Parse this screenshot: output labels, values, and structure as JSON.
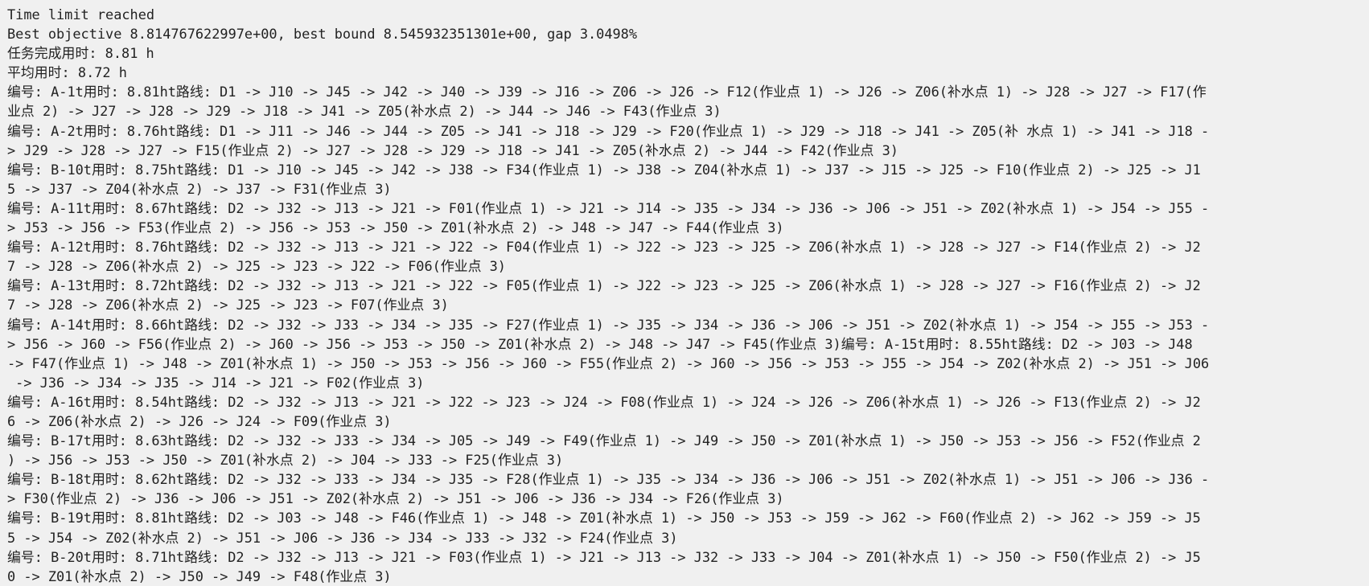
{
  "console": {
    "lines": [
      "Time limit reached",
      "Best objective 8.814767622997e+00, best bound 8.545932351301e+00, gap 3.0498%",
      "任务完成用时: 8.81 h",
      "平均用时: 8.72 h",
      "编号: A-1t用时: 8.81ht路线: D1 -> J10 -> J45 -> J42 -> J40 -> J39 -> J16 -> Z06 -> J26 -> F12(作业点 1) -> J26 -> Z06(补水点 1) -> J28 -> J27 -> F17(作",
      "业点 2) -> J27 -> J28 -> J29 -> J18 -> J41 -> Z05(补水点 2) -> J44 -> J46 -> F43(作业点 3)",
      "编号: A-2t用时: 8.76ht路线: D1 -> J11 -> J46 -> J44 -> Z05 -> J41 -> J18 -> J29 -> F20(作业点 1) -> J29 -> J18 -> J41 -> Z05(补 水点 1) -> J41 -> J18 -",
      "> J29 -> J28 -> J27 -> F15(作业点 2) -> J27 -> J28 -> J29 -> J18 -> J41 -> Z05(补水点 2) -> J44 -> F42(作业点 3)",
      "编号: B-10t用时: 8.75ht路线: D1 -> J10 -> J45 -> J42 -> J38 -> F34(作业点 1) -> J38 -> Z04(补水点 1) -> J37 -> J15 -> J25 -> F10(作业点 2) -> J25 -> J1",
      "5 -> J37 -> Z04(补水点 2) -> J37 -> F31(作业点 3)",
      "编号: A-11t用时: 8.67ht路线: D2 -> J32 -> J13 -> J21 -> F01(作业点 1) -> J21 -> J14 -> J35 -> J34 -> J36 -> J06 -> J51 -> Z02(补水点 1) -> J54 -> J55 -",
      "> J53 -> J56 -> F53(作业点 2) -> J56 -> J53 -> J50 -> Z01(补水点 2) -> J48 -> J47 -> F44(作业点 3)",
      "编号: A-12t用时: 8.76ht路线: D2 -> J32 -> J13 -> J21 -> J22 -> F04(作业点 1) -> J22 -> J23 -> J25 -> Z06(补水点 1) -> J28 -> J27 -> F14(作业点 2) -> J2",
      "7 -> J28 -> Z06(补水点 2) -> J25 -> J23 -> J22 -> F06(作业点 3)",
      "编号: A-13t用时: 8.72ht路线: D2 -> J32 -> J13 -> J21 -> J22 -> F05(作业点 1) -> J22 -> J23 -> J25 -> Z06(补水点 1) -> J28 -> J27 -> F16(作业点 2) -> J2",
      "7 -> J28 -> Z06(补水点 2) -> J25 -> J23 -> F07(作业点 3)",
      "编号: A-14t用时: 8.66ht路线: D2 -> J32 -> J33 -> J34 -> J35 -> F27(作业点 1) -> J35 -> J34 -> J36 -> J06 -> J51 -> Z02(补水点 1) -> J54 -> J55 -> J53 -",
      "> J56 -> J60 -> F56(作业点 2) -> J60 -> J56 -> J53 -> J50 -> Z01(补水点 2) -> J48 -> J47 -> F45(作业点 3)编号: A-15t用时: 8.55ht路线: D2 -> J03 -> J48",
      "-> F47(作业点 1) -> J48 -> Z01(补水点 1) -> J50 -> J53 -> J56 -> J60 -> F55(作业点 2) -> J60 -> J56 -> J53 -> J55 -> J54 -> Z02(补水点 2) -> J51 -> J06",
      " -> J36 -> J34 -> J35 -> J14 -> J21 -> F02(作业点 3)",
      "编号: A-16t用时: 8.54ht路线: D2 -> J32 -> J13 -> J21 -> J22 -> J23 -> J24 -> F08(作业点 1) -> J24 -> J26 -> Z06(补水点 1) -> J26 -> F13(作业点 2) -> J2",
      "6 -> Z06(补水点 2) -> J26 -> J24 -> F09(作业点 3)",
      "编号: B-17t用时: 8.63ht路线: D2 -> J32 -> J33 -> J34 -> J05 -> J49 -> F49(作业点 1) -> J49 -> J50 -> Z01(补水点 1) -> J50 -> J53 -> J56 -> F52(作业点 2",
      ") -> J56 -> J53 -> J50 -> Z01(补水点 2) -> J04 -> J33 -> F25(作业点 3)",
      "编号: B-18t用时: 8.62ht路线: D2 -> J32 -> J33 -> J34 -> J35 -> F28(作业点 1) -> J35 -> J34 -> J36 -> J06 -> J51 -> Z02(补水点 1) -> J51 -> J06 -> J36 -",
      "> F30(作业点 2) -> J36 -> J06 -> J51 -> Z02(补水点 2) -> J51 -> J06 -> J36 -> J34 -> F26(作业点 3)",
      "编号: B-19t用时: 8.81ht路线: D2 -> J03 -> J48 -> F46(作业点 1) -> J48 -> Z01(补水点 1) -> J50 -> J53 -> J59 -> J62 -> F60(作业点 2) -> J62 -> J59 -> J5",
      "5 -> J54 -> Z02(补水点 2) -> J51 -> J06 -> J36 -> J34 -> J33 -> J32 -> F24(作业点 3)",
      "编号: B-20t用时: 8.71ht路线: D2 -> J32 -> J13 -> J21 -> F03(作业点 1) -> J21 -> J13 -> J32 -> J33 -> J04 -> Z01(补水点 1) -> J50 -> F50(作业点 2) -> J5",
      "0 -> Z01(补水点 2) -> J50 -> J49 -> F48(作业点 3)"
    ]
  }
}
